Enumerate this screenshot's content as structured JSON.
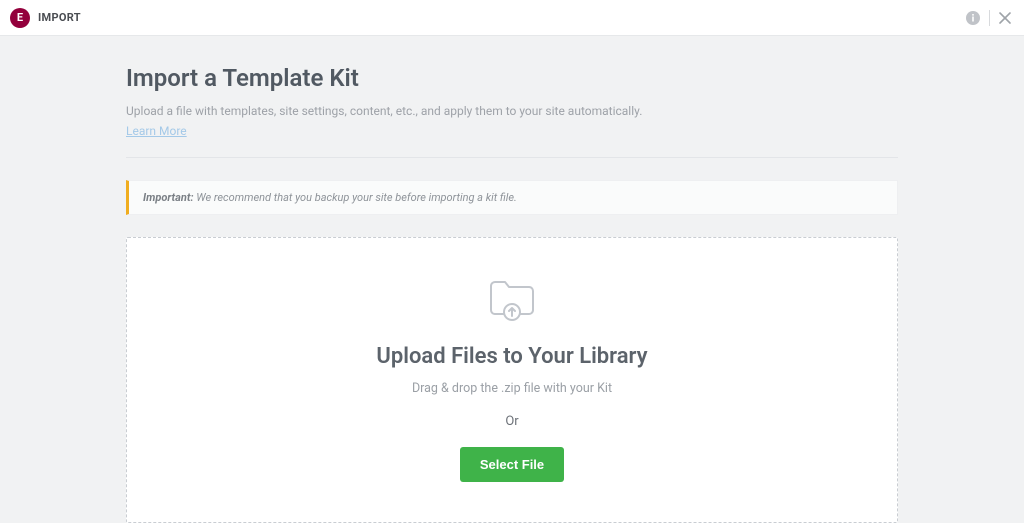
{
  "header": {
    "logo_text": "E",
    "title": "IMPORT"
  },
  "page": {
    "heading": "Import a Template Kit",
    "subtitle": "Upload a file with templates, site settings, content, etc., and apply them to your site automatically.",
    "learn_more": "Learn More"
  },
  "notice": {
    "label": "Important:",
    "text": " We recommend that you backup your site before importing a kit file."
  },
  "dropzone": {
    "heading": "Upload Files to Your Library",
    "subtitle": "Drag & drop the .zip file with your Kit",
    "or": "Or",
    "button": "Select File"
  }
}
